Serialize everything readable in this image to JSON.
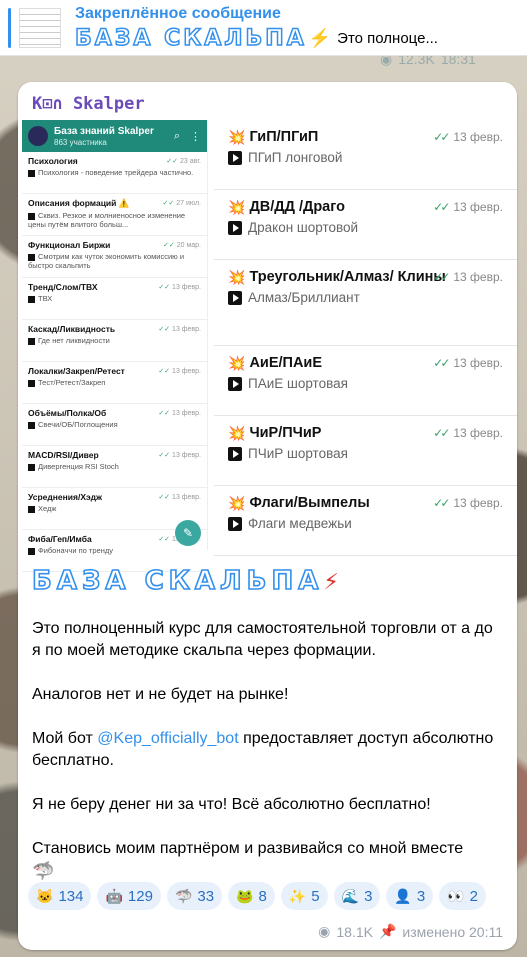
{
  "pinned": {
    "title": "Закреплённое сообщение",
    "logo": "БАЗА СКАЛЬПА",
    "preview": "Это полноце..."
  },
  "prev_meta": {
    "views": "12.3K",
    "time": "18:31"
  },
  "brand": "K⊡∩ Skalper",
  "phone": {
    "title": "База знаний Skalper",
    "subtitle": "863 участника",
    "items": [
      {
        "title": "Психология",
        "date": "23 авг.",
        "text": "Психология - поведение трейдера частично."
      },
      {
        "title": "Описания формаций ⚠️",
        "date": "27 июл.",
        "text": "Сквиз. Резкое и молниеносное изменение цены путём влитого больш..."
      },
      {
        "title": "Функционал Биржи",
        "date": "20 мар.",
        "text": "Смотрим как чуток экономить комиссию и быстро скальпить"
      },
      {
        "title": "Тренд/Слом/ТВХ",
        "date": "13 февр.",
        "text": "ТВХ"
      },
      {
        "title": "Каскад/Ликвидность",
        "date": "13 февр.",
        "text": "Где нет ликвидности"
      },
      {
        "title": "Локалки/Закреп/Ретест",
        "date": "13 февр.",
        "text": "Тест/Ретест/Закреп"
      },
      {
        "title": "Объёмы/Полка/Об",
        "date": "13 февр.",
        "text": "Свечи/ОБ/Поглощения"
      },
      {
        "title": "MACD/RSI/Дивер",
        "date": "13 февр.",
        "text": "Дивергенция RSI Stoch"
      },
      {
        "title": "Усреднения/Хэдж",
        "date": "13 февр.",
        "text": "Хедж"
      },
      {
        "title": "Фиба/Геп/Имба",
        "date": "13 февр.",
        "text": "Фибоначчи по тренду"
      }
    ]
  },
  "right_list": [
    {
      "title": "ГиП/ПГиП",
      "date": "13 февр.",
      "sub": "ПГиП лонговой"
    },
    {
      "title": "ДВ/ДД /Драго",
      "date": "13 февр.",
      "sub": "Дракон шортовой"
    },
    {
      "title": "Треугольник/Алмаз/ Клины",
      "date": "13 февр.",
      "sub": "Алмаз/Бриллиант"
    },
    {
      "title": "АиЕ/ПАиЕ",
      "date": "13 февр.",
      "sub": "ПАиЕ шортовая"
    },
    {
      "title": "ЧиР/ПЧиР",
      "date": "13 февр.",
      "sub": "ПЧиР шортовая"
    },
    {
      "title": "Флаги/Вымпелы",
      "date": "13 февр.",
      "sub": "Флаги медвежьи"
    }
  ],
  "message": {
    "logo": "БАЗА СКАЛЬПА",
    "p1": "Это полноценный курс для самостоятельной торговли от а до я по моей методике скальпа через формации.",
    "p2": "Аналогов нет и не будет на рынке!",
    "p3_before": "Мой бот ",
    "p3_mention": "@Kep_officially_bot",
    "p3_after": " предоставляет доступ абсолютно бесплатно.",
    "p4": "Я не беру денег ни за что! Всё абсолютно бесплатно!",
    "p5": "Становись моим партнёром и развивайся со мной вместе"
  },
  "reactions": [
    {
      "icon": "cat-icon",
      "count": "134"
    },
    {
      "icon": "robot-icon",
      "count": "129"
    },
    {
      "icon": "shark-icon",
      "count": "33"
    },
    {
      "icon": "frog-icon",
      "count": "8"
    },
    {
      "icon": "sparkle-icon",
      "count": "5"
    },
    {
      "icon": "wave-icon",
      "count": "3"
    },
    {
      "icon": "person-icon",
      "count": "3"
    },
    {
      "icon": "eyes-icon",
      "count": "2"
    }
  ],
  "meta": {
    "views": "18.1K",
    "edited": "изменено 20:11"
  }
}
